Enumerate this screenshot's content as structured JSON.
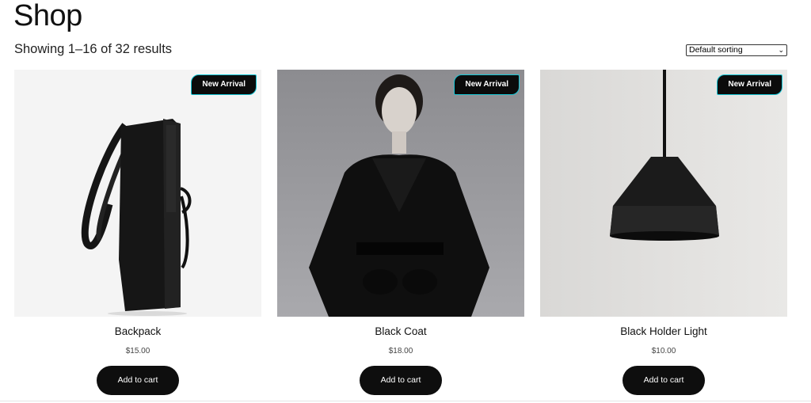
{
  "page": {
    "title": "Shop",
    "result_count": "Showing 1–16 of 32 results"
  },
  "sorting": {
    "selected": "Default sorting",
    "icon": "chevron-down-icon"
  },
  "products": [
    {
      "name": "Backpack",
      "price": "$15.00",
      "badge": "New Arrival",
      "button": "Add to cart",
      "image": "backpack-photo"
    },
    {
      "name": "Black Coat",
      "price": "$18.00",
      "badge": "New Arrival",
      "button": "Add to cart",
      "image": "black-coat-photo"
    },
    {
      "name": "Black Holder Light",
      "price": "$10.00",
      "badge": "New Arrival",
      "button": "Add to cart",
      "image": "pendant-lamp-photo"
    }
  ],
  "colors": {
    "button_bg": "#0e0e0e",
    "badge_bg": "#0b0b0b",
    "badge_border": "#17c7d6"
  }
}
